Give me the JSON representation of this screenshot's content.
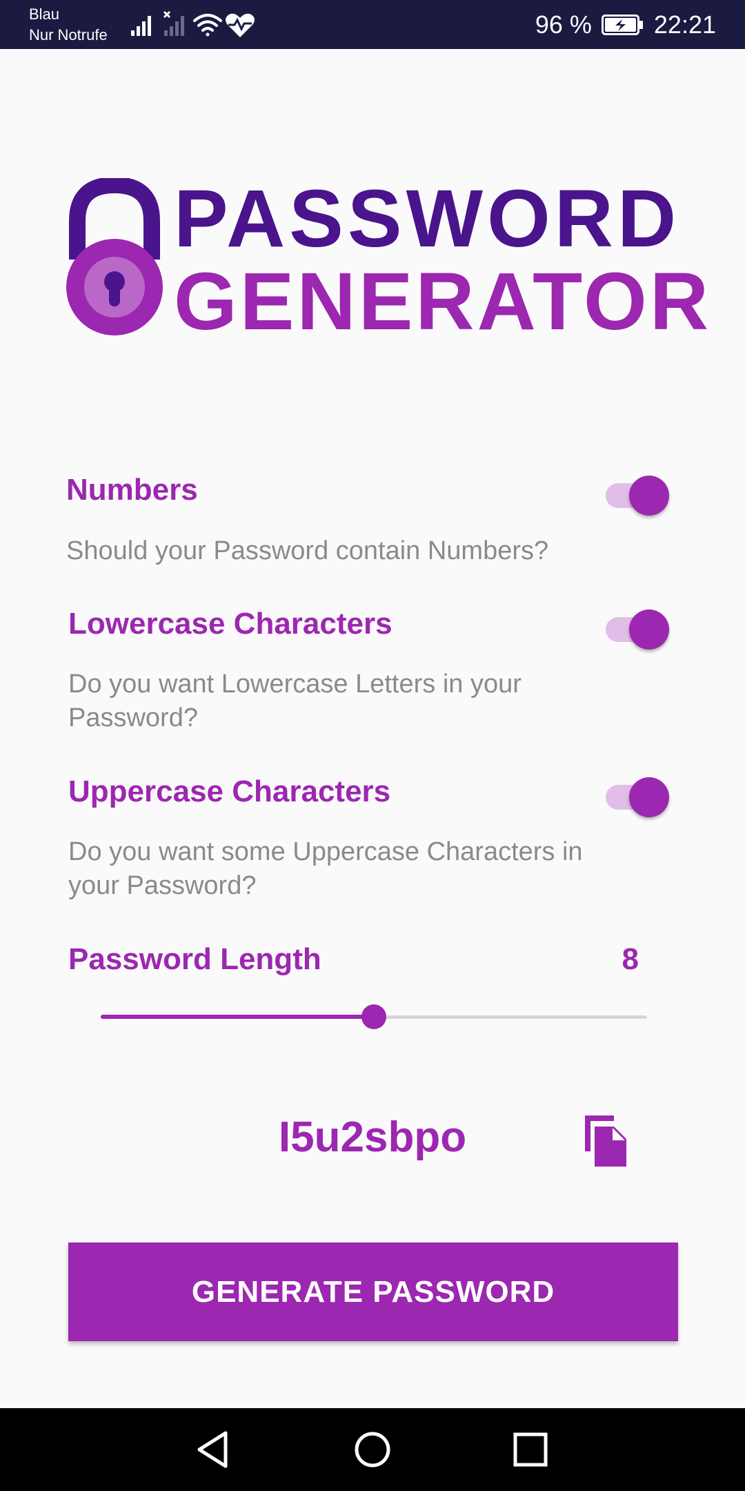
{
  "status_bar": {
    "carrier_line1": "Blau",
    "carrier_line2": "Nur Notrufe",
    "battery_percent": "96 %",
    "time": "22:21",
    "icons": [
      "signal-icon",
      "signal-off-icon",
      "wifi-icon",
      "health-icon",
      "battery-charging-icon"
    ]
  },
  "logo": {
    "line1": "PASSWORD",
    "line2": "GENERATOR",
    "icon": "padlock-icon",
    "colors": {
      "dark": "#4a148c",
      "light": "#9c27b0"
    }
  },
  "options": {
    "numbers": {
      "title": "Numbers",
      "description": "Should your Password contain Numbers?",
      "enabled": true
    },
    "lowercase": {
      "title": "Lowercase Characters",
      "description": "Do you want Lowercase Letters in your Password?",
      "enabled": true
    },
    "uppercase": {
      "title": "Uppercase Characters",
      "description": "Do you want some Uppercase Characters in your Password?",
      "enabled": true
    }
  },
  "length": {
    "title": "Password Length",
    "value": "8",
    "slider_fraction": 0.5
  },
  "output": {
    "password": "I5u2sbpo",
    "copy_icon": "copy-icon"
  },
  "generate_button": {
    "label": "GENERATE PASSWORD"
  },
  "nav_bar": {
    "icons": [
      "back-icon",
      "home-icon",
      "recents-icon"
    ]
  },
  "colors": {
    "accent": "#9c27b0",
    "accent_light": "#e1bee7",
    "status_bar": "#1b1a40",
    "description_text": "#8a8a8a"
  }
}
